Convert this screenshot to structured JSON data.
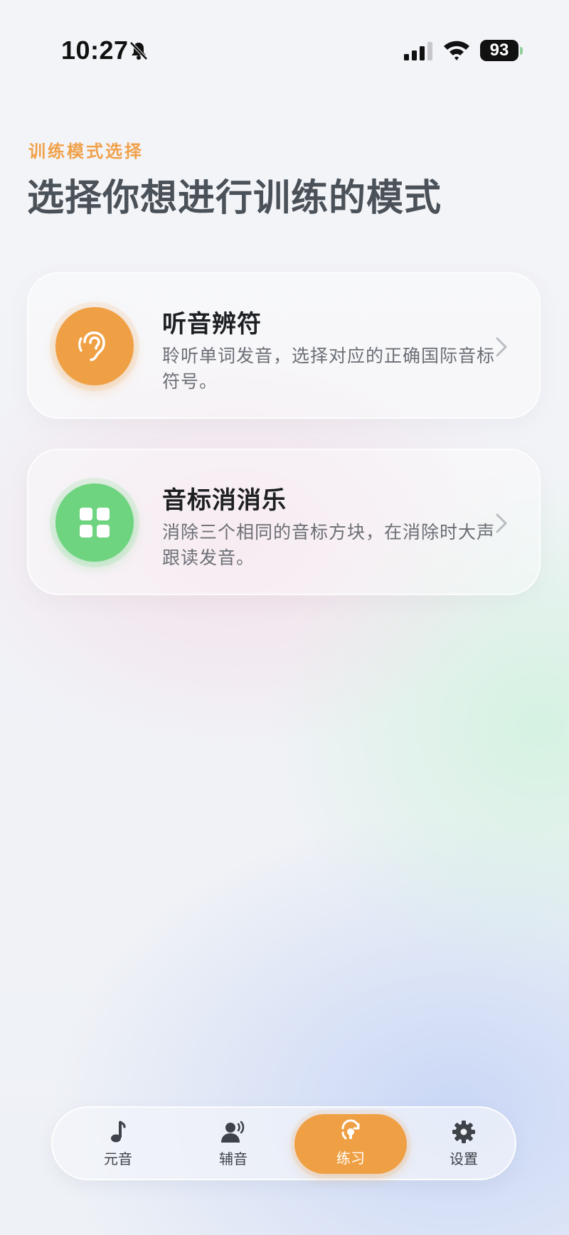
{
  "status_bar": {
    "time": "10:27",
    "battery": "93"
  },
  "header": {
    "kicker": "训练模式选择",
    "title": "选择你想进行训练的模式"
  },
  "modes": [
    {
      "title": "听音辨符",
      "description": "聆听单词发音，选择对应的正确国际音标符号。",
      "icon": "ear-icon",
      "color": "#f0a044"
    },
    {
      "title": "音标消消乐",
      "description": "消除三个相同的音标方块，在消除时大声跟读发音。",
      "icon": "grid-icon",
      "color": "#6ed47f"
    }
  ],
  "tab_bar": {
    "active": "练习",
    "items": [
      {
        "label": "元音",
        "icon": "music-note-icon"
      },
      {
        "label": "辅音",
        "icon": "speaking-person-icon"
      },
      {
        "label": "练习",
        "icon": "practice-icon"
      },
      {
        "label": "设置",
        "icon": "gear-icon"
      }
    ]
  },
  "colors": {
    "accent": "#f0a044",
    "green": "#6ed47f",
    "title": "#4b5158"
  }
}
